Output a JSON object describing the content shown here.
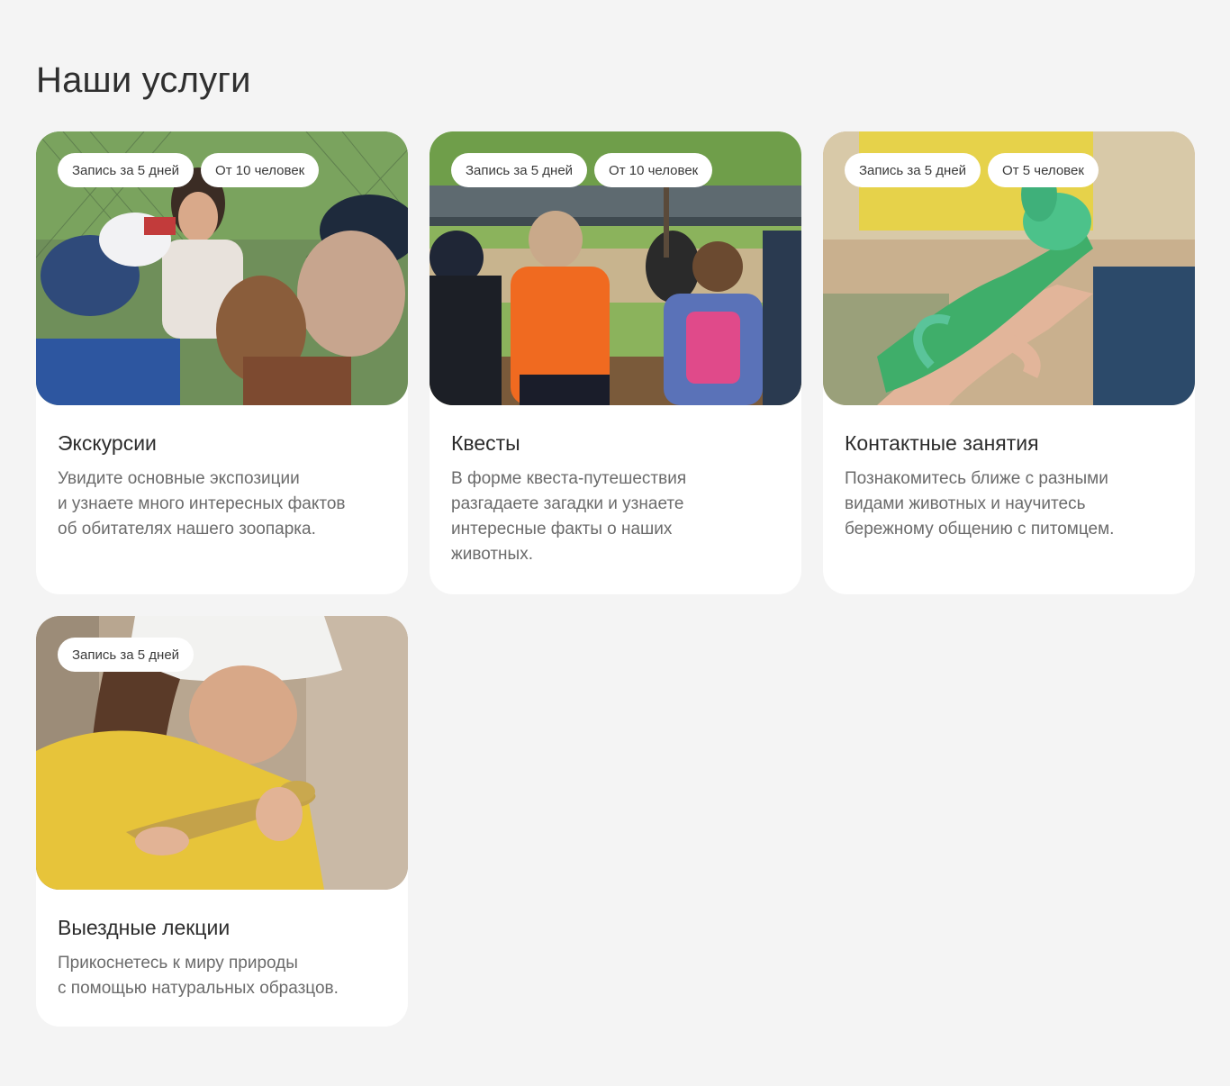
{
  "section": {
    "title": "Наши услуги"
  },
  "cards": [
    {
      "badges": [
        "Запись за 5 дней",
        "От 10 человек"
      ],
      "title": "Экскурсии",
      "text": "Увидите основные экспозиции\nи узнаете много интересных фактов\nоб обитателях нашего зоопарка."
    },
    {
      "badges": [
        "Запись за 5 дней",
        "От 10 человек"
      ],
      "title": "Квесты",
      "text": "В форме квеста-путешествия\nразгадаете загадки и узнаете\nинтересные факты о наших\nживотных."
    },
    {
      "badges": [
        "Запись за 5 дней",
        "От 5 человек"
      ],
      "title": "Контактные занятия",
      "text": "Познакомитесь ближе с разными\nвидами животных и научитесь\nбережному общению с питомцем."
    },
    {
      "badges": [
        "Запись за 5 дней"
      ],
      "title": "Выездные лекции",
      "text": "Прикоснетесь к миру природы\nс помощью натуральных образцов."
    }
  ]
}
